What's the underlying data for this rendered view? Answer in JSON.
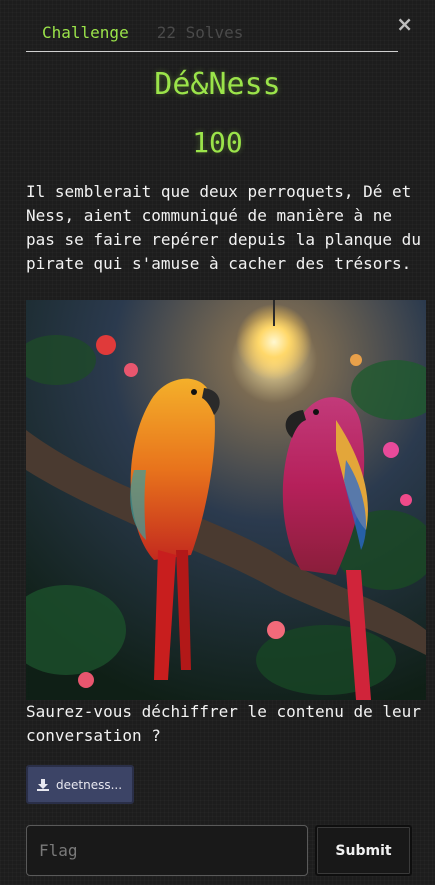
{
  "modal": {
    "close_glyph": "×",
    "tabs": {
      "challenge": "Challenge",
      "solves": "22 Solves"
    },
    "title": "Dé&Ness",
    "points": "100",
    "description": "Il semblerait que deux perroquets, Dé et Ness, aient communiqué de manière à ne pas se faire repérer depuis la planque du pirate qui s'amuse à cacher des trésors.",
    "question": "Saurez-vous déchiffrer le contenu de leur conversation ?",
    "file_label": "deetness...",
    "flag_placeholder": "Flag",
    "submit_label": "Submit"
  },
  "colors": {
    "accent": "#9be44a",
    "background": "#1d1d1d",
    "file_button": "#3c4466"
  },
  "icons": {
    "download": "download-icon",
    "close": "close-icon"
  }
}
